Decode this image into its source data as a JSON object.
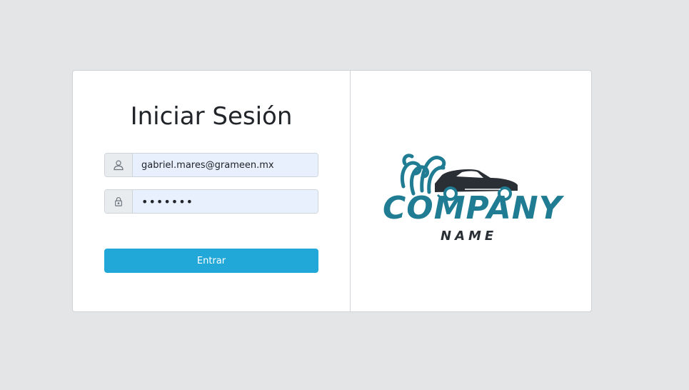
{
  "login": {
    "title": "Iniciar Sesión",
    "email_value": "gabriel.mares@grameen.mx",
    "password_value": "•••••••",
    "submit_label": "Entrar",
    "icons": {
      "user": "user-icon",
      "password": "lock-icon"
    }
  },
  "brand": {
    "main_text": "COMPANY",
    "sub_text": "NAME",
    "colors": {
      "accent": "#1f7c93",
      "dark": "#2a2f35"
    }
  },
  "colors": {
    "page_bg": "#e4e5e7",
    "button_bg": "#22a8d8",
    "autofill_bg": "#e8f0fe"
  }
}
